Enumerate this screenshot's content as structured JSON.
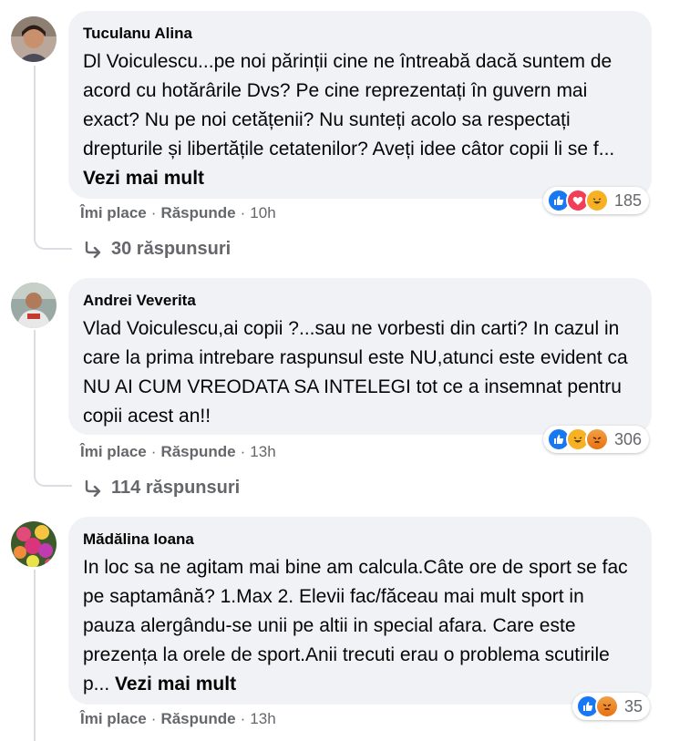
{
  "comments": [
    {
      "author": "Tuculanu Alina",
      "text": "Dl Voiculescu...pe noi părinții cine ne întreabă dacă suntem de acord cu hotărârile Dvs? Pe cine reprezentați în guvern mai exact? Nu pe noi cetățenii? Nu sunteți acolo sa respectați drepturile și libertățile cetatenilor? Aveți idee câtor copii li se f... ",
      "see_more": "Vezi mai mult",
      "like": "Îmi place",
      "reply": "Răspunde",
      "time": "10h",
      "reactions": [
        "like",
        "love",
        "haha"
      ],
      "reaction_count": "185",
      "replies": "30 răspunsuri"
    },
    {
      "author": "Andrei Veverita",
      "text": "Vlad Voiculescu,ai copii ?...sau ne vorbesti din carti? In cazul in care la prima intrebare raspunsul este NU,atunci este evident ca NU AI CUM VREODATA SA INTELEGI tot ce a insemnat pentru copii acest an!!",
      "see_more": "",
      "like": "Îmi place",
      "reply": "Răspunde",
      "time": "13h",
      "reactions": [
        "like",
        "haha",
        "angry"
      ],
      "reaction_count": "306",
      "replies": "114 răspunsuri"
    },
    {
      "author": "Mădălina Ioana",
      "text": "In loc sa ne agitam mai bine am calcula.Câte ore de sport se fac pe saptamână? 1.Max 2. Elevii fac/făceau mai mult sport in pauza alergându-se unii pe altii in special afara. Care este prezența la orele de sport.Anii trecuti erau o problema scutirile p... ",
      "see_more": "Vezi mai mult",
      "like": "Îmi place",
      "reply": "Răspunde",
      "time": "13h",
      "reactions": [
        "like",
        "angry"
      ],
      "reaction_count": "35",
      "replies": ""
    }
  ],
  "colors": {
    "bubble": "#f0f2f5",
    "secondary_text": "#65676b",
    "like_blue": "#1877f2",
    "love_red": "#f33e58",
    "haha_yellow": "#f7b125",
    "angry_orange": "#e9710f"
  }
}
